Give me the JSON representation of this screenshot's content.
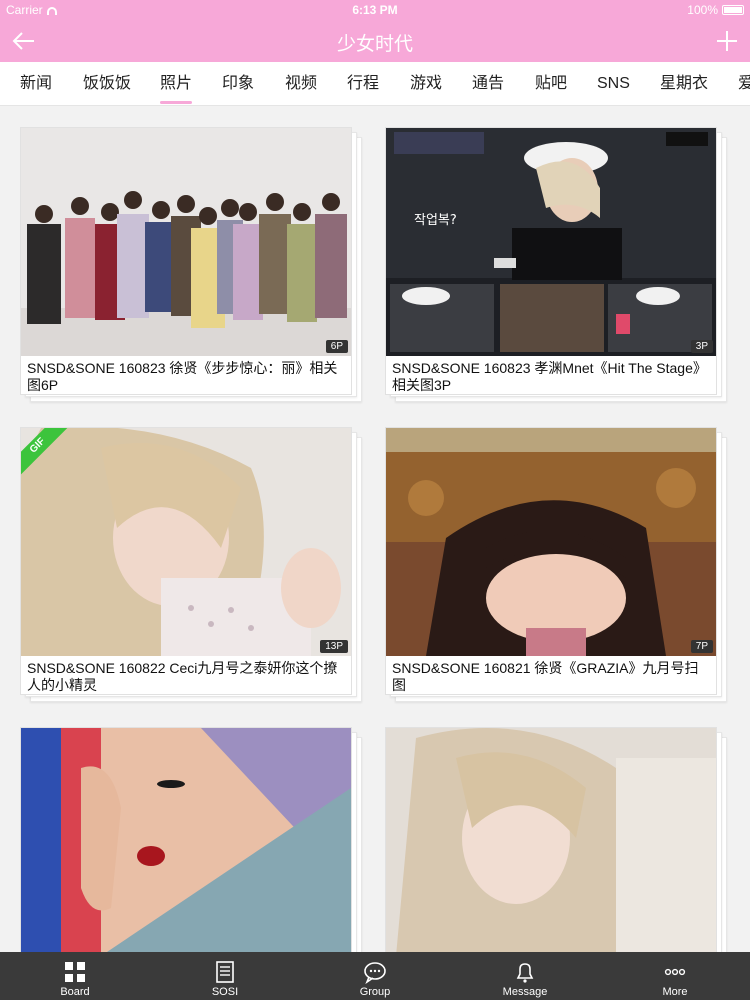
{
  "status": {
    "carrier": "Carrier",
    "time": "6:13 PM",
    "battery": "100%"
  },
  "header": {
    "title": "少女时代"
  },
  "tabs": [
    {
      "label": "新闻"
    },
    {
      "label": "饭饭饭"
    },
    {
      "label": "照片"
    },
    {
      "label": "印象"
    },
    {
      "label": "视频"
    },
    {
      "label": "行程"
    },
    {
      "label": "游戏"
    },
    {
      "label": "通告"
    },
    {
      "label": "贴吧"
    },
    {
      "label": "SNS"
    },
    {
      "label": "星期衣"
    },
    {
      "label": "爱"
    }
  ],
  "active_tab": "照片",
  "posts": [
    {
      "caption": "SNSD&SONE 160823 徐贤《步步惊心：丽》相关图6P",
      "badge": "6P"
    },
    {
      "caption": "SNSD&SONE 160823 孝渊Mnet《Hit The Stage》相关图3P",
      "badge": "3P"
    },
    {
      "caption": "SNSD&SONE 160822 Ceci九月号之泰妍你这个撩人的小精灵",
      "badge": "13P",
      "gif": "GIF"
    },
    {
      "caption": "SNSD&SONE 160821 徐贤《GRAZIA》九月号扫图",
      "badge": "7P"
    },
    {
      "caption": "",
      "badge": ""
    },
    {
      "caption": "",
      "badge": ""
    }
  ],
  "bottom_nav": [
    {
      "label": "Board",
      "icon": "grid-icon"
    },
    {
      "label": "SOSI",
      "icon": "document-icon"
    },
    {
      "label": "Group",
      "icon": "chat-bubble-icon"
    },
    {
      "label": "Message",
      "icon": "bell-icon"
    },
    {
      "label": "More",
      "icon": "more-dots-icon"
    }
  ],
  "colors": {
    "accent": "#f7a8d8",
    "nav_bg": "#3a3a3a",
    "gif": "#3cc43c"
  }
}
